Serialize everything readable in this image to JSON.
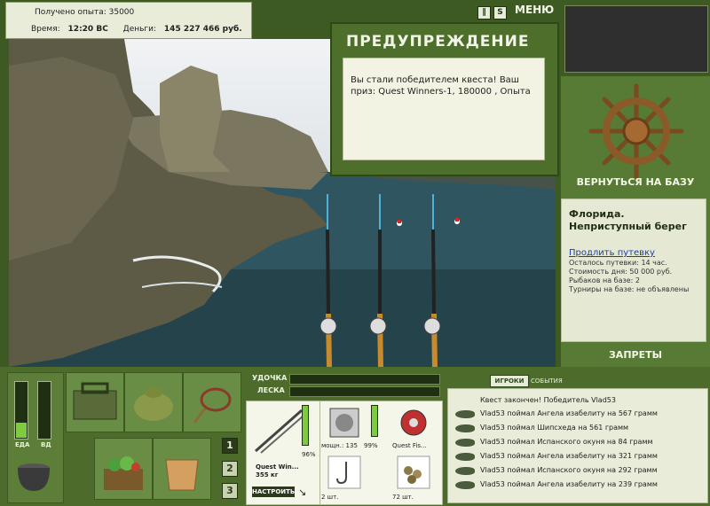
{
  "top": {
    "exp_label": "Получено опыта:",
    "exp_value": "35000",
    "time_label": "Время:",
    "time_value": "12:20 ВС",
    "money_label": "Деньги:",
    "money_value": "145 227 466 руб."
  },
  "toolbar": {
    "pause_icon": "pause-icon",
    "sound_icon": "s-icon",
    "menu_label": "МЕНЮ"
  },
  "warning": {
    "title": "ПРЕДУПРЕЖДЕНИЕ",
    "message": "Вы стали победителем квеста! Ваш приз: Quest Winners-1, 180000 , Опыта"
  },
  "right_panel": {
    "return_label": "ВЕРНУТЬСЯ НА БАЗУ",
    "location_title": "Флорида. Неприступный берег",
    "extend_link": "Продлить путевку",
    "lines": [
      "Осталось путевки: 14 час.",
      "Стоимость дня: 50 000 руб.",
      "Рыбаков на базе: 2",
      "Турниры на базе: не объявлены"
    ],
    "bans_label": "ЗАПРЕТЫ"
  },
  "meters": {
    "food_label": "ЕДА",
    "drink_label": "ВД",
    "food_level": 0.28,
    "drink_level": 0.0
  },
  "numbers": [
    "1",
    "2",
    "3"
  ],
  "tackle": {
    "rod_label": "УДОЧКА",
    "line_label": "ЛЕСКА",
    "rod_name": "Quest Win...",
    "rod_weight": "355 кг",
    "rod_percent": "96%",
    "setup_label": "НАСТРОИТЬ",
    "reel_caption": "мощн.: 135",
    "reel_percent": "99%",
    "line_caption": "Quest Fis...",
    "hook_count": "2 шт.",
    "bait_count": "72 шт."
  },
  "chat": {
    "tab_players": "ИГРОКИ",
    "tab_events": "СОБЫТИЯ",
    "header": "Квест закончен! Победитель Vlad53",
    "messages": [
      "Vlad53 поймал Ангела изабелиту на 567 грамм",
      "Vlad53 поймал Шипсхеда на 561 грамм",
      "Vlad53 поймал Испанского окуня на 84 грамм",
      "Vlad53 поймал Ангела изабелиту на 321 грамм",
      "Vlad53 поймал Испанского окуня на 292 грамм",
      "Vlad53 поймал Ангела изабелиту на 239 грамм"
    ]
  }
}
